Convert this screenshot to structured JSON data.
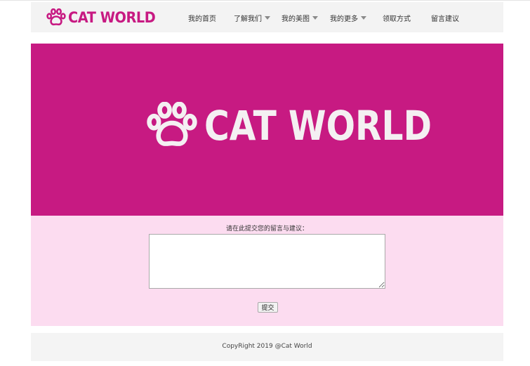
{
  "brand": {
    "name": "CAT WORLD",
    "color": "#c71a82"
  },
  "nav": {
    "items": [
      {
        "label": "我的首页",
        "has_dropdown": false
      },
      {
        "label": "了解我们",
        "has_dropdown": true
      },
      {
        "label": "我的美图",
        "has_dropdown": true
      },
      {
        "label": "我的更多",
        "has_dropdown": true
      },
      {
        "label": "领取方式",
        "has_dropdown": false
      },
      {
        "label": "留言建议",
        "has_dropdown": false
      }
    ]
  },
  "hero": {
    "title": "CAT WORLD",
    "background": "#c71a82",
    "icon": "paw-icon"
  },
  "form": {
    "label": "请在此提交您的留言与建议：",
    "message_value": "",
    "submit_label": "提交",
    "background": "#fcdcf0"
  },
  "footer": {
    "text": "CopyRight 2019  @Cat World"
  }
}
